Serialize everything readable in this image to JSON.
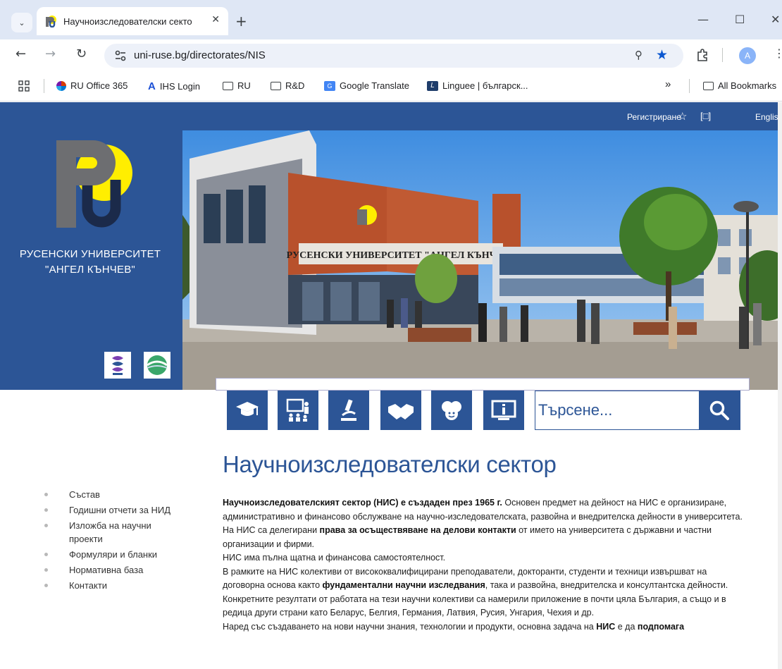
{
  "browser": {
    "tab_title": "Научноизследователски секто",
    "url": "uni-ruse.bg/directorates/NIS",
    "avatar_letter": "A",
    "bookmarks": [
      "RU Office 365",
      "IHS Login",
      "RU",
      "R&D",
      "Google Translate",
      "Linguee | българск...",
      "All Bookmarks"
    ],
    "bookmarks_overflow": "»"
  },
  "header": {
    "register": "Регистриране",
    "language": "English",
    "university_line1": "РУСЕНСКИ УНИВЕРСИТЕТ",
    "university_line2": "\"АНГЕЛ КЪНЧЕВ\"",
    "building_sign": "РУСЕНСКИ УНИВЕРСИТЕТ \"АНГЕЛ КЪНЧЕВ\""
  },
  "search": {
    "placeholder": "Търсене..."
  },
  "sidebar": {
    "items": [
      "Състав",
      "Годишни отчети за НИД",
      "Изложба на научни проекти",
      "Формуляри и бланки",
      "Нормативна база",
      "Контакти"
    ]
  },
  "main": {
    "title": "Научноизследователски сектор",
    "p1_bold": "Научноизследователският сектор (НИС) е създаден през 1965 г.",
    "p1_text": " Основен предмет на дейност на НИС е организиране, административно и финансово обслужване на научно-изследователската, развойна и внедрителска дейности в университета.",
    "p2_pre": "На НИС са делегирани ",
    "p2_bold": "права за осъществяване на делови контакти",
    "p2_post": " от името на университета с държавни и частни организации и фирми.",
    "p3": "НИС има пълна щатна и финансова самостоятелност.",
    "p4_pre": "В рамките на НИС колективи от висококвалифицирани преподаватели, докторанти, студенти и техници извършват на договорна основа както ",
    "p4_bold": "фундаментални научни изследвания",
    "p4_post": ", така и развойна, внедрителска и консултантска дейности.",
    "p5": "Конкретните резултати от работата на тези научни колективи са намерили приложение в почти цяла България, а също и в редица други страни като Беларус, Белгия, Германия, Латвия, Русия, Унгария, Чехия и др.",
    "p6_pre": "Наред със създаването на нови научни знания, технологии и продукти, основна задача на ",
    "p6_bold1": "НИС",
    "p6_mid": " е да ",
    "p6_bold2": "подпомага"
  },
  "colors": {
    "brand_blue": "#2c5596",
    "logo_yellow": "#ffee00",
    "logo_gray": "#6d6e71"
  }
}
